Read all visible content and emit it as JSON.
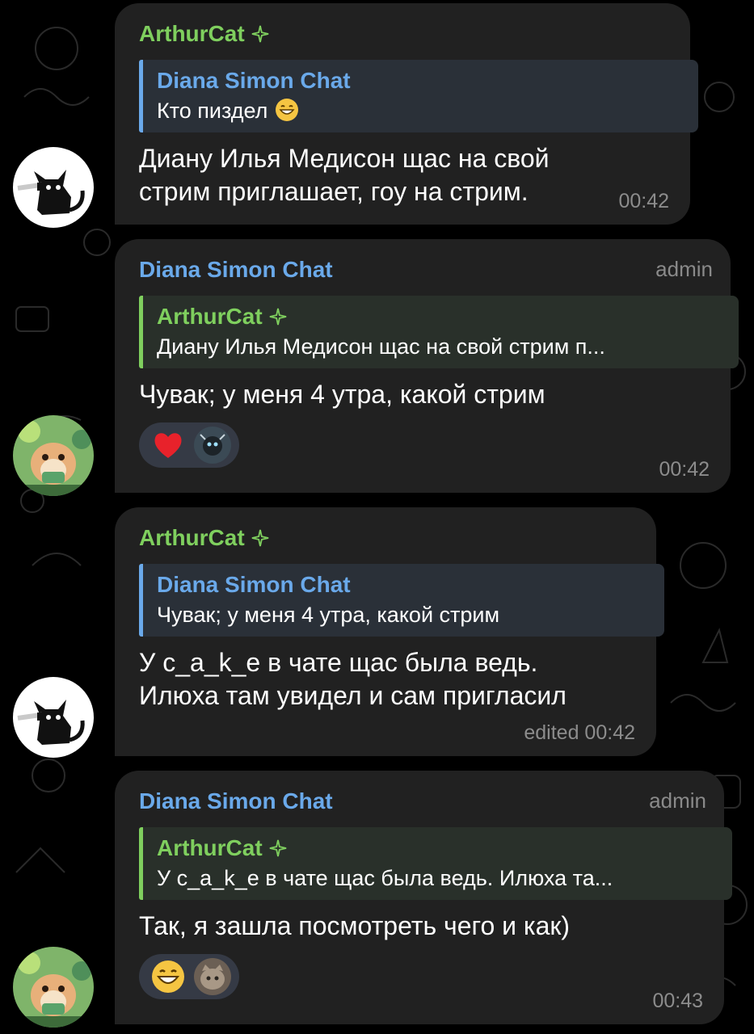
{
  "messages": [
    {
      "sender": "ArthurCat",
      "reply_name": "Diana Simon Chat",
      "reply_text": "Кто пиздел",
      "text_line1": "Диану Илья Медисон щас на свой",
      "text_line2": "стрим приглашает, гоу на стрим.",
      "time": "00:42"
    },
    {
      "sender": "Diana Simon Chat",
      "tag": "admin",
      "reply_name": "ArthurCat",
      "reply_text": "Диану Илья Медисон щас на свой стрим п...",
      "text_line1": "Чувак; у меня 4 утра, какой стрим",
      "time": "00:42",
      "reactions": [
        "heart-reaction",
        "cat-avatar"
      ]
    },
    {
      "sender": "ArthurCat",
      "reply_name": "Diana Simon Chat",
      "reply_text": "Чувак; у меня 4 утра, какой стрим",
      "text_line1": "У c_a_k_e в чате щас была ведь.",
      "text_line2": "Илюха там увидел и сам пригласил",
      "time": "edited 00:42"
    },
    {
      "sender": "Diana Simon Chat",
      "tag": "admin",
      "reply_name": "ArthurCat",
      "reply_text": "У c_a_k_e в чате щас была ведь. Илюха та...",
      "text_line1": "Так, я зашла посмотреть чего и как)",
      "time": "00:43",
      "reactions": [
        "grin-reaction",
        "cat-avatar"
      ]
    }
  ],
  "colors": {
    "background": "#000000",
    "bubble": "#212121",
    "green_name": "#7fcf5e",
    "blue_name": "#6aa9ea",
    "time": "#8c8c8c"
  }
}
